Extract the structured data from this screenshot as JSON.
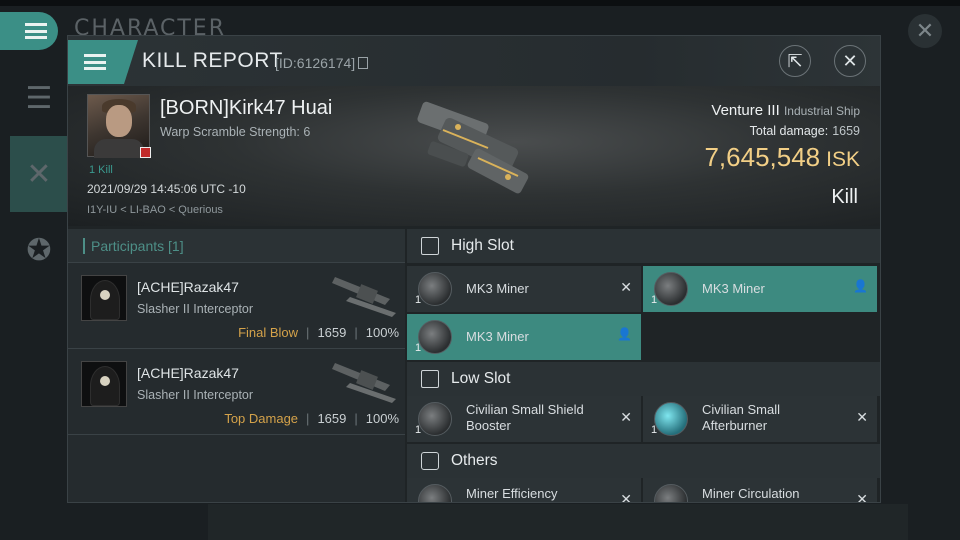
{
  "background": {
    "title": "CHARACTER"
  },
  "dialog": {
    "title": "KILL REPORT",
    "report_id": "[ID:6126174]"
  },
  "victim": {
    "name": "[BORN]Kirk47 Huai",
    "warp_scramble": "Warp Scramble Strength: 6",
    "kills": "1 Kill",
    "timestamp": "2021/09/29 14:45:06 UTC -10",
    "location": "I1Y-IU < LI-BAO < Querious",
    "ship_name": "Venture III",
    "ship_class": "Industrial Ship",
    "total_damage_label": "Total damage:",
    "total_damage": "1659",
    "isk_value": "7,645,548",
    "isk_unit": "ISK",
    "result": "Kill"
  },
  "participants": {
    "header": "Participants [1]",
    "rows": [
      {
        "name": "[ACHE]Razak47",
        "ship": "Slasher II Interceptor",
        "tag": "Final Blow",
        "damage": "1659",
        "percent": "100%"
      },
      {
        "name": "[ACHE]Razak47",
        "ship": "Slasher II Interceptor",
        "tag": "Top Damage",
        "damage": "1659",
        "percent": "100%"
      }
    ]
  },
  "slots": {
    "high": {
      "title": "High Slot",
      "modules": [
        {
          "name": "MK3 Miner",
          "qty": "1",
          "state": "destroyed"
        },
        {
          "name": "MK3 Miner",
          "qty": "1",
          "state": "dropped"
        },
        {
          "name": "MK3 Miner",
          "qty": "1",
          "state": "dropped"
        }
      ]
    },
    "low": {
      "title": "Low Slot",
      "modules": [
        {
          "name": "Civilian Small Shield Booster",
          "qty": "1",
          "state": "destroyed"
        },
        {
          "name": "Civilian Small Afterburner",
          "qty": "1",
          "state": "destroyed"
        }
      ]
    },
    "others": {
      "title": "Others",
      "modules": [
        {
          "name": "Miner Efficiency",
          "qty": "1",
          "state": "destroyed"
        },
        {
          "name": "Miner Circulation",
          "qty": "1",
          "state": "destroyed"
        }
      ]
    }
  },
  "colors": {
    "accent": "#3b8f86",
    "isk": "#f2cf86",
    "tag": "#d4a24a"
  }
}
